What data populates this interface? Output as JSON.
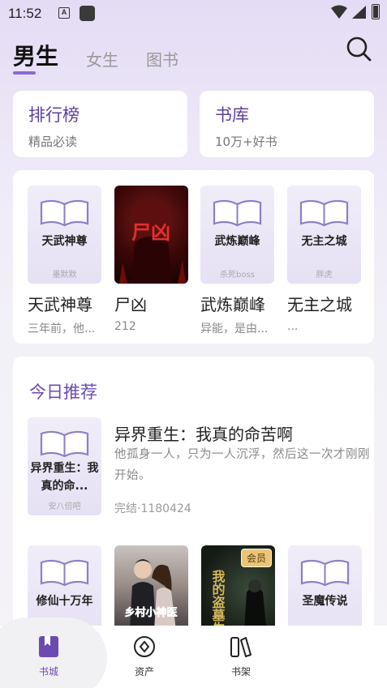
{
  "status_bar": {
    "time": "11:52",
    "notification_icons": [
      "a-box-icon",
      "app-square-icon"
    ],
    "system_icons": [
      "wifi-icon",
      "signal-icon",
      "battery-icon"
    ]
  },
  "top_tabs": [
    {
      "label": "男生",
      "active": true
    },
    {
      "label": "女生",
      "active": false
    },
    {
      "label": "图书",
      "active": false
    }
  ],
  "quick_links": [
    {
      "title": "排行榜",
      "subtitle": "精品必读"
    },
    {
      "title": "书库",
      "subtitle": "10万+好书"
    }
  ],
  "book_row": [
    {
      "cover_title": "天武神尊",
      "cover_author": "墨默默",
      "name": "天武神尊",
      "sub": "三年前，他..."
    },
    {
      "cover_title": "尸凶",
      "cover_image": "red-horror-cover",
      "name": "尸凶",
      "sub": "212"
    },
    {
      "cover_title": "武炼巅峰",
      "cover_author": "杀死boss",
      "name": "武炼巅峰",
      "sub": "异能，是由..."
    },
    {
      "cover_title": "无主之城",
      "cover_author": "胖虎",
      "name": "无主之城",
      "sub": "..."
    }
  ],
  "recommend": {
    "heading": "今日推荐",
    "featured": {
      "cover_title": "异界重生：我真的命...",
      "cover_author": "安八倍吧",
      "title": "异界重生：我真的命苦啊",
      "description": "他孤身一人，只为一人沉浮，然后这一次才刚刚开始。",
      "meta": "完结·1180424"
    },
    "more": [
      {
        "cover_title": "修仙十万年",
        "cover_image": "placeholder-book"
      },
      {
        "cover_title": "乡村小神医",
        "cover_image": "couple-photo-cover"
      },
      {
        "cover_title": "我的盗墓生涯",
        "cover_image": "dark-tomb-cover",
        "badge": "会员"
      },
      {
        "cover_title": "圣魔传说",
        "cover_image": "placeholder-book"
      }
    ]
  },
  "bottom_nav": [
    {
      "label": "书城",
      "icon": "bookmark-book-icon",
      "active": true
    },
    {
      "label": "资产",
      "icon": "coin-diamond-icon",
      "active": false
    },
    {
      "label": "书架",
      "icon": "bookshelf-icon",
      "active": false
    }
  ],
  "colors": {
    "accent": "#6b4bb0",
    "background_top": "#e4dcf4",
    "card": "#ffffff"
  }
}
